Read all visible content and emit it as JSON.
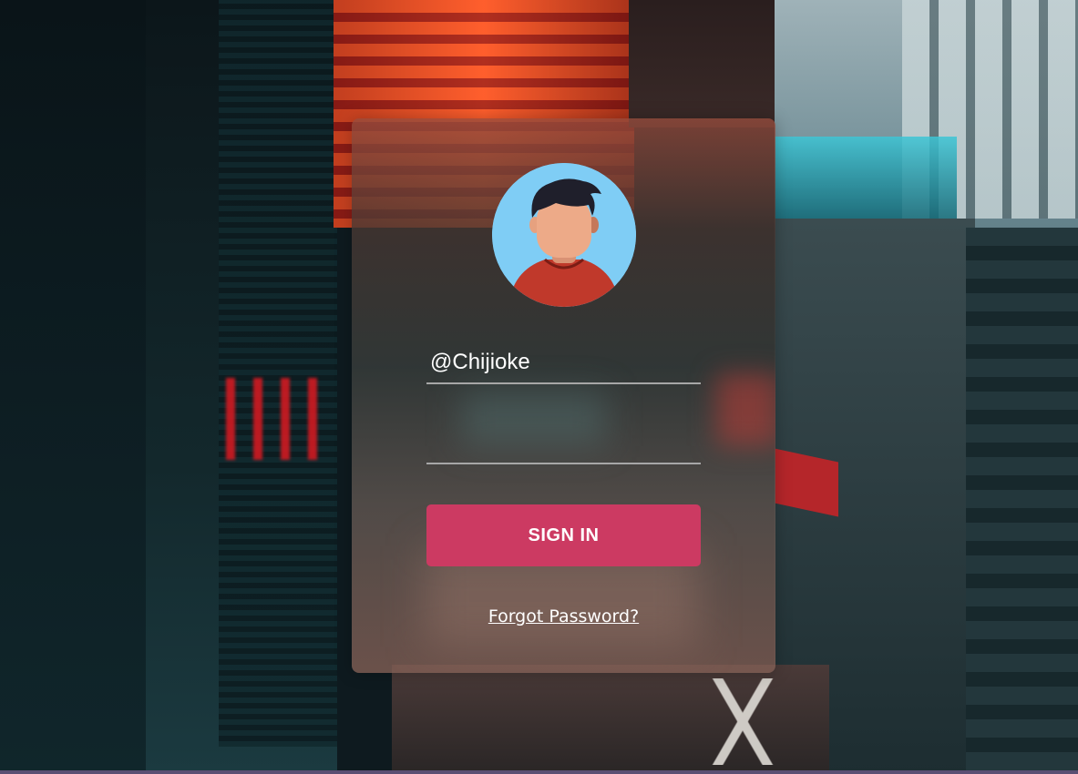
{
  "login": {
    "avatar_icon": "user-avatar-icon",
    "username_value": "@Chijioke",
    "password_value": "",
    "signin_label": "SIGN IN",
    "forgot_label": "Forgot Password?"
  },
  "colors": {
    "button": "#cc3a62",
    "avatar_bg": "#7fcdf5"
  }
}
